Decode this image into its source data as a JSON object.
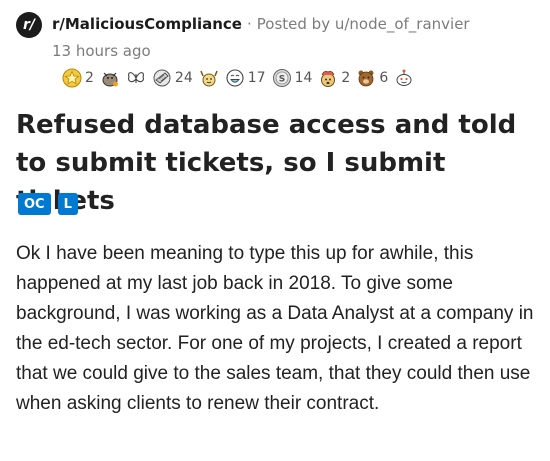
{
  "post": {
    "subreddit_icon": "r/",
    "subreddit": "r/MaliciousCompliance",
    "separator": "·",
    "posted_by": "Posted by u/node_of_ranvier",
    "time": "13 hours ago",
    "title": "Refused database access and told to submit tickets, so I submit tickets",
    "flairs": [
      "OC",
      "L"
    ],
    "body": "Ok I have been meaning to type this up for awhile, this happened at my last job back in 2018. To give some background, I was working as a Data Analyst at a company in the ed-tech sector. For one of my projects, I created a report that we could give to the sales team, that they could then use when asking clients to renew their contract."
  },
  "awards": [
    {
      "icon": "gold-star-award-icon",
      "count": "2"
    },
    {
      "icon": "wholesome-seal-award-icon",
      "count": ""
    },
    {
      "icon": "butterfly-award-icon",
      "count": ""
    },
    {
      "icon": "facepalm-award-icon",
      "count": "24"
    },
    {
      "icon": "take-my-energy-award-icon",
      "count": ""
    },
    {
      "icon": "laughing-face-award-icon",
      "count": "17"
    },
    {
      "icon": "silver-coin-award-icon",
      "count": "14"
    },
    {
      "icon": "mindblown-award-icon",
      "count": "2"
    },
    {
      "icon": "bear-award-icon",
      "count": "6"
    },
    {
      "icon": "snoo-award-icon",
      "count": ""
    }
  ],
  "colors": {
    "flair_bg": "#0079d3",
    "meta_gray": "#7c7c7c",
    "text": "#222222"
  }
}
